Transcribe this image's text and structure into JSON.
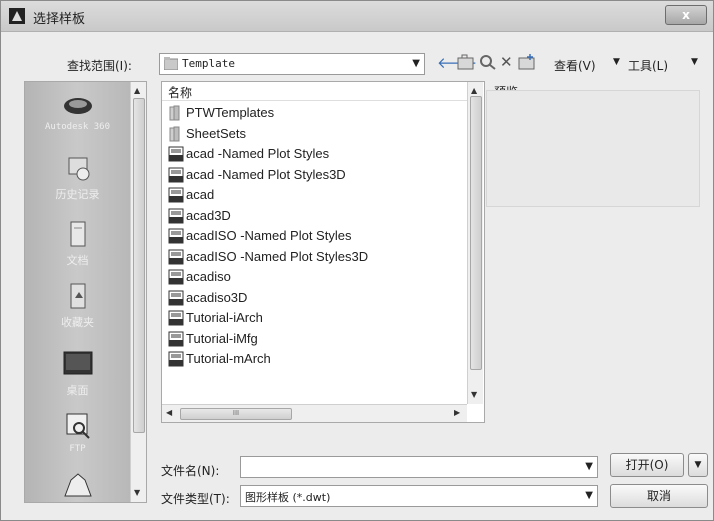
{
  "window": {
    "title": "选择样板",
    "close_glyph": "x"
  },
  "toolbar": {
    "lookin_label": "查找范围(I):",
    "lookin_value": "Template",
    "views_label": "查看(V)",
    "tools_label": "工具(L)"
  },
  "places": {
    "items": [
      {
        "label": "Autodesk 360",
        "icon": "cloud-icon"
      },
      {
        "label": "历史记录",
        "icon": "history-icon"
      },
      {
        "label": "文档",
        "icon": "documents-icon"
      },
      {
        "label": "收藏夹",
        "icon": "favorites-icon"
      },
      {
        "label": "桌面",
        "icon": "desktop-icon"
      },
      {
        "label": "FTP",
        "icon": "ftp-icon"
      },
      {
        "label": "",
        "icon": "buzzsaw-icon"
      }
    ]
  },
  "filelist": {
    "column_name": "名称",
    "files": [
      {
        "name": "PTWTemplates",
        "type": "folder"
      },
      {
        "name": "SheetSets",
        "type": "folder"
      },
      {
        "name": "acad -Named Plot Styles",
        "type": "dwt"
      },
      {
        "name": "acad -Named Plot Styles3D",
        "type": "dwt"
      },
      {
        "name": "acad",
        "type": "dwt"
      },
      {
        "name": "acad3D",
        "type": "dwt"
      },
      {
        "name": "acadISO -Named Plot Styles",
        "type": "dwt"
      },
      {
        "name": "acadISO -Named Plot Styles3D",
        "type": "dwt"
      },
      {
        "name": "acadiso",
        "type": "dwt"
      },
      {
        "name": "acadiso3D",
        "type": "dwt"
      },
      {
        "name": "Tutorial-iArch",
        "type": "dwt"
      },
      {
        "name": "Tutorial-iMfg",
        "type": "dwt"
      },
      {
        "name": "Tutorial-mArch",
        "type": "dwt"
      }
    ],
    "hscroll_grip": "III"
  },
  "preview": {
    "label": "预览"
  },
  "form": {
    "filename_label": "文件名(N):",
    "filename_value": "",
    "filetype_label": "文件类型(T):",
    "filetype_value": "图形样板 (*.dwt)"
  },
  "buttons": {
    "open": "打开(O)",
    "cancel": "取消"
  },
  "colors": {
    "titlebar": "#d0d0d0",
    "places_bg": "#bdbdbd",
    "list_bg": "#ffffff",
    "accent_arrow": "#3a6fb7"
  }
}
